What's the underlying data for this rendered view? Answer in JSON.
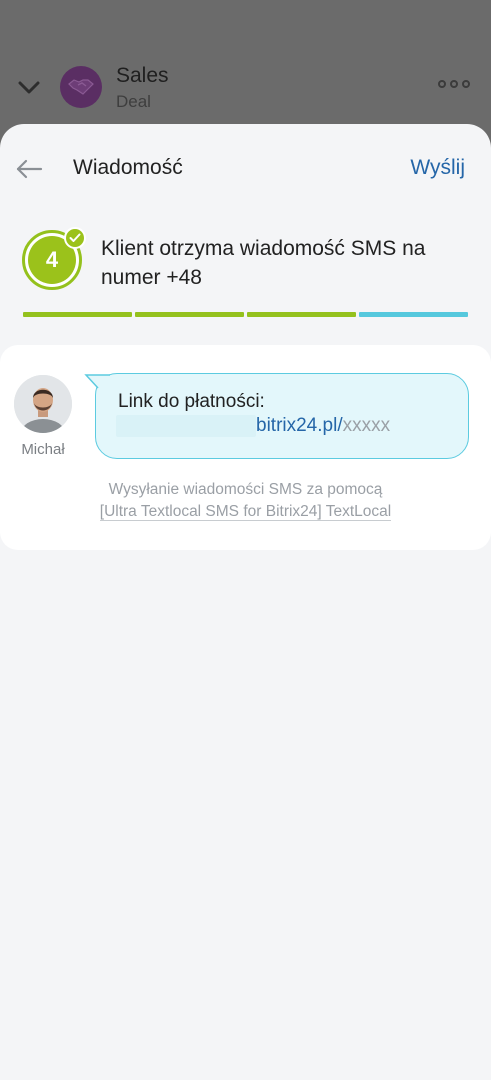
{
  "background_header": {
    "title": "Sales",
    "subtitle": "Deal"
  },
  "topbar": {
    "title": "Wiadomość",
    "send_label": "Wyślij"
  },
  "step": {
    "number": "4",
    "text": "Klient otrzyma wiadomość SMS na numer +48",
    "progress_colors": [
      "#94c11d",
      "#94c11d",
      "#94c11d",
      "#55c8dd"
    ]
  },
  "message": {
    "sender_name": "Michał",
    "line1": "Link do płatności:",
    "link_host": "bitrix24.pl",
    "link_sep": "/",
    "link_tail": "xxxxx"
  },
  "footer": {
    "line1": "Wysyłanie wiadomości SMS za pomocą",
    "line2": "[Ultra Textlocal SMS for Bitrix24] TextLocal"
  },
  "colors": {
    "accent_blue": "#2566a8",
    "step_green": "#9bc21b",
    "bubble_bg": "#e3f7fb",
    "bubble_border": "#5ccbe0"
  }
}
